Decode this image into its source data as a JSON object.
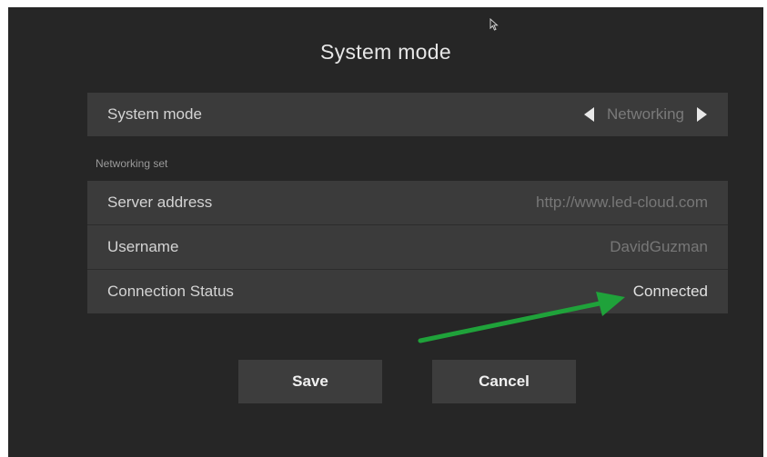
{
  "dialog": {
    "title": "System mode"
  },
  "system_mode": {
    "label": "System mode",
    "value": "Networking",
    "prev_icon": "triangle-left-icon",
    "next_icon": "triangle-right-icon"
  },
  "networking_set": {
    "section_label": "Networking set",
    "server_address": {
      "label": "Server address",
      "value": "http://www.led-cloud.com"
    },
    "username": {
      "label": "Username",
      "value": "DavidGuzman"
    },
    "connection_status": {
      "label": "Connection Status",
      "value": "Connected"
    }
  },
  "buttons": {
    "save_label": "Save",
    "cancel_label": "Cancel"
  },
  "colors": {
    "background": "#262626",
    "row_background": "#3b3b3b",
    "button_background": "#3d3d3d",
    "annotation_arrow": "#1fa23a"
  },
  "icons": {
    "cursor": "mouse-pointer-icon",
    "annotation": "green-arrow-icon"
  }
}
